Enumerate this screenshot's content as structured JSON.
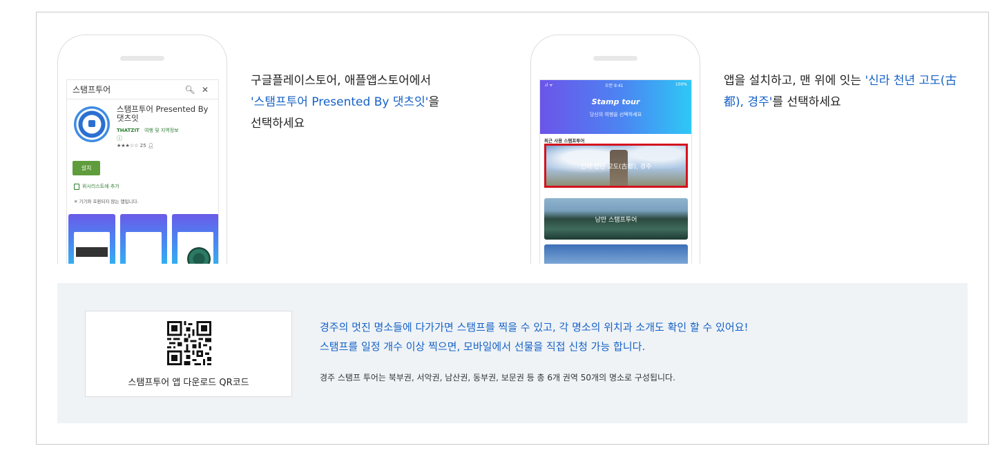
{
  "step1": {
    "phone": {
      "search_query": "스탬프투어",
      "app_name": "스탬프투어 Presented By 댓츠잇",
      "developer": "THATZIT",
      "category": "여행 및 지역정보",
      "rating_count": "25",
      "install_label": "설치",
      "wishlist_label": "위시리스트에 추가",
      "compat_note": "기기와 호환되지 않는 앱입니다."
    },
    "text_line1": "구글플레이스토어, 애플앱스토어에서",
    "text_highlight": "'스탬프투어 Presented By 댓츠잇'",
    "text_after_highlight": "을",
    "text_line3": "선택하세요"
  },
  "step2": {
    "phone": {
      "status_time": "오전 9:41",
      "status_battery": "100%",
      "title": "Stamp tour",
      "subtitle": "당신의 여행을 선택하세요",
      "recent_label": "최근 사용 스탬프투어",
      "cards": [
        "신라 천년 고도(古都), 경주",
        "낭만 스탬프투어"
      ]
    },
    "text_before": "앱을 설치하고, 맨 위에 잇는 ",
    "text_highlight": "'신라 천년 고도(古都), 경주'",
    "text_after": "를 선택하세요"
  },
  "qr": {
    "caption": "스탬프투어 앱 다운로드 QR코드"
  },
  "info": {
    "line1": "경주의 멋진 명소들에 다가가면 스탬프를 찍을 수 있고, 각 명소의 위치과 소개도 확인 할 수 있어요!",
    "line2": "스탬프를 일정 개수 이상 찍으면, 모바일에서 선물을 직접 신청 가능 합니다.",
    "sub": "경주 스탬프 투어는 북부권, 서악권, 남산권, 동부권, 보문권 등 총 6개 권역 50개의 명소로 구성됩니다."
  },
  "colors": {
    "highlight": "#1561c6",
    "panel_bg": "#eff3f6",
    "selected_border": "#d4121e",
    "install_green": "#5f9c3c"
  }
}
